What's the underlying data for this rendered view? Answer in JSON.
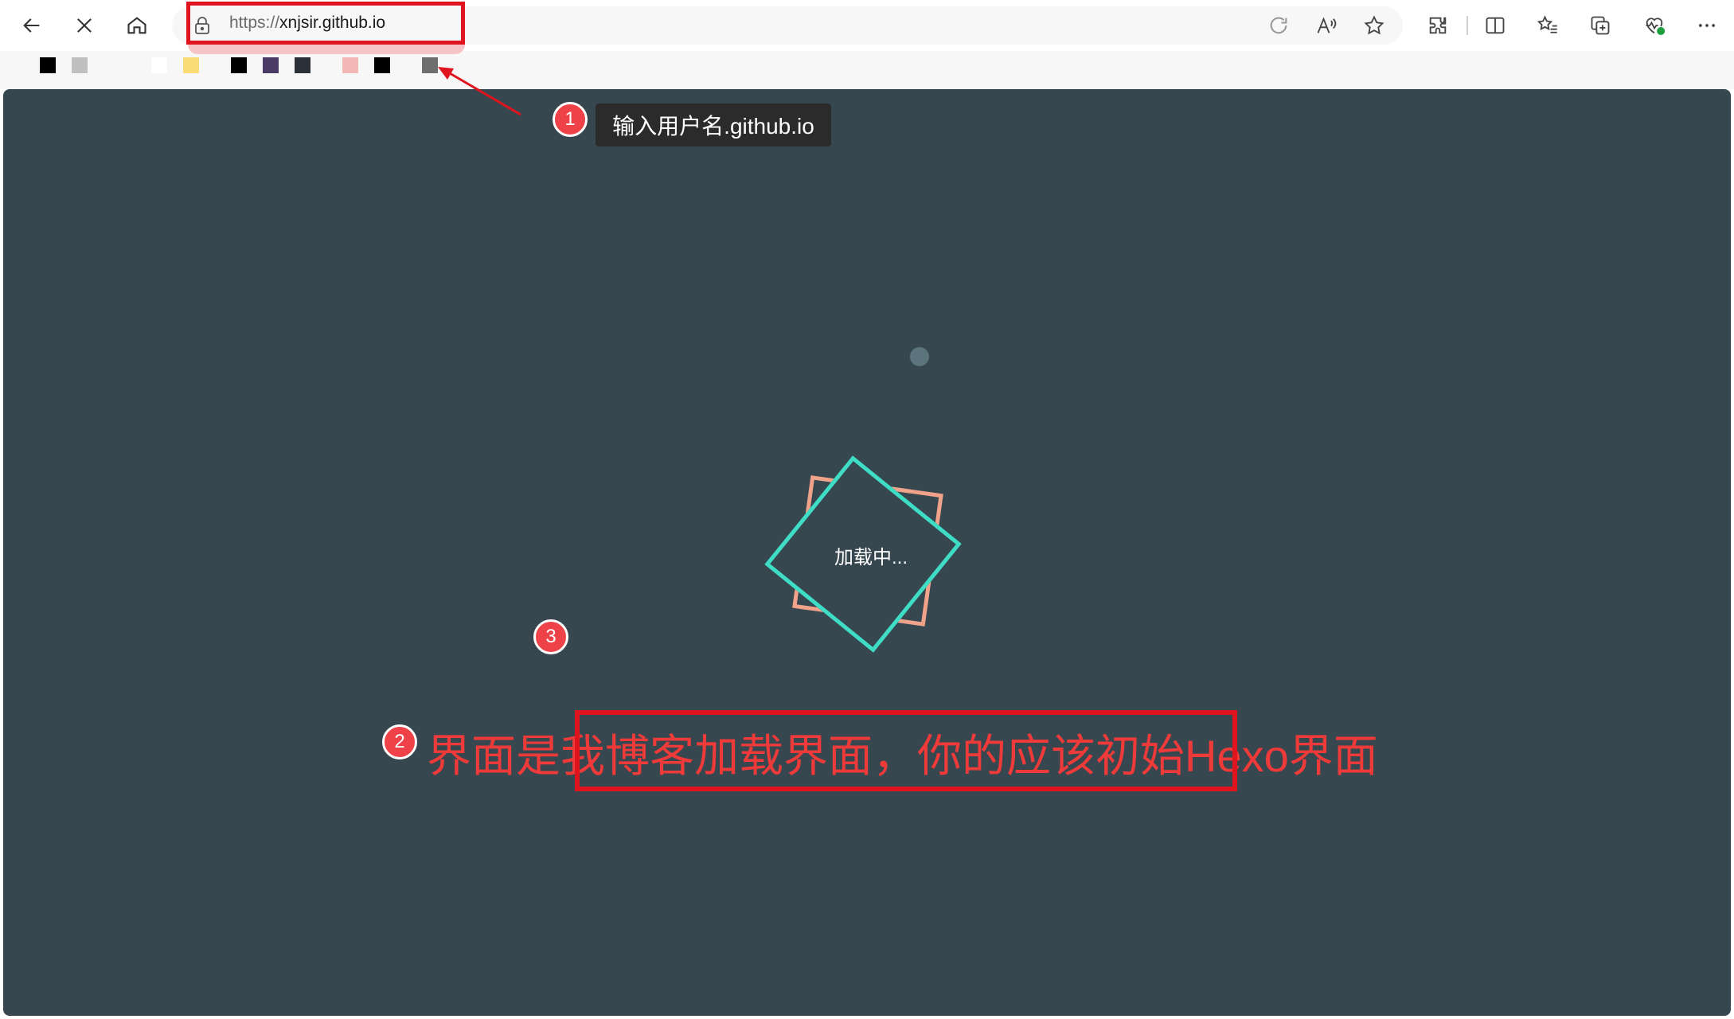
{
  "browser": {
    "url_scheme": "https://",
    "url_host": "xnjsir.github.io",
    "bookmark_colors": [
      "#000000",
      "#c0c0c0",
      "#ffffff",
      "#f9dc75",
      "#000000",
      "#4a3b66",
      "#2c3039",
      "#f2b8b5",
      "#000000",
      "#6e6e6e"
    ]
  },
  "page": {
    "loading_text": "加载中...",
    "background_color": "#37474f",
    "loader_colors": {
      "front": "#3fdcc6",
      "back": "#f0a38a"
    }
  },
  "annotations": {
    "step1_number": "1",
    "step1_tooltip": "输入用户名.github.io",
    "step2_number": "2",
    "step2_note": "界面是我博客加载界面，你的应该初始Hexo界面",
    "step3_number": "3",
    "accent_color": "#e0141e"
  }
}
